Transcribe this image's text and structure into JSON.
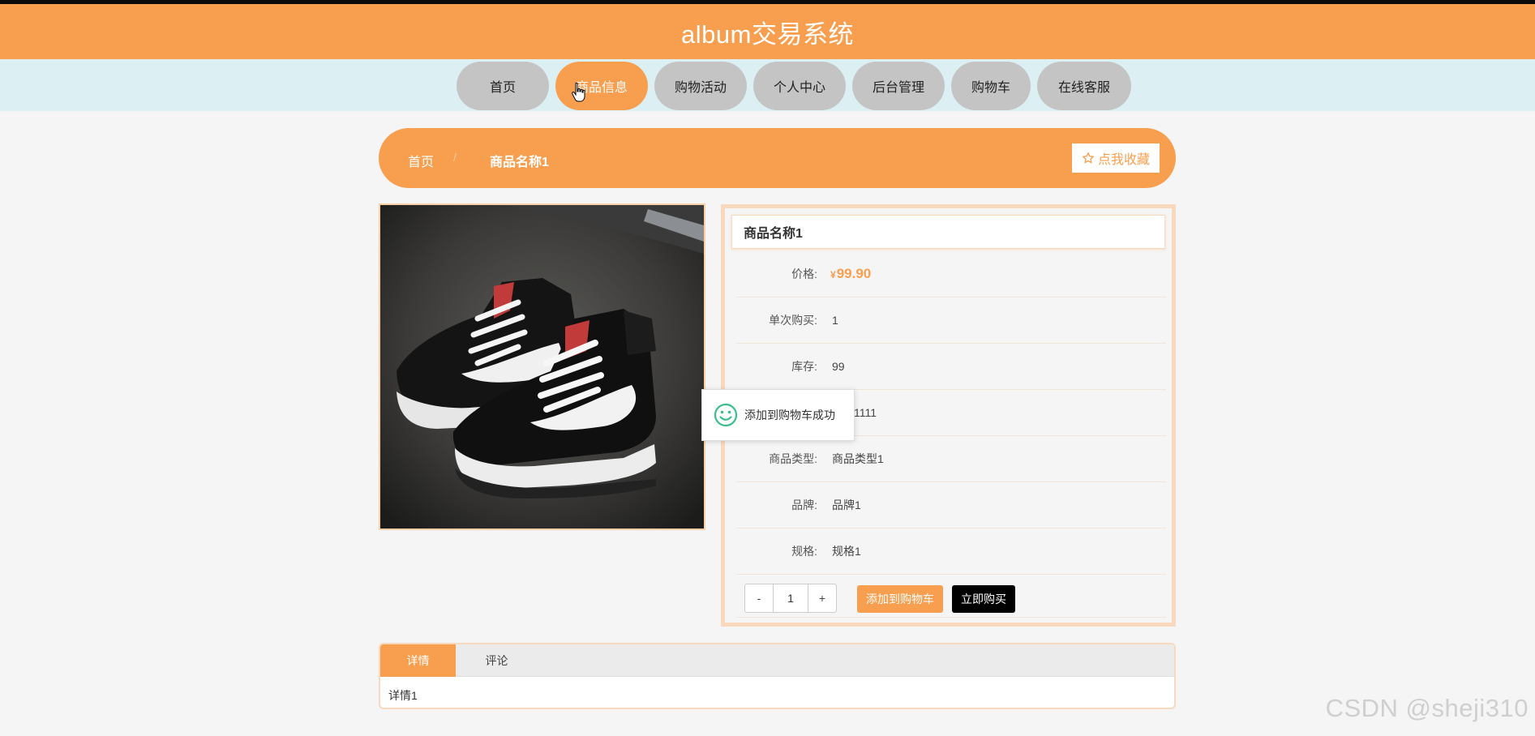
{
  "header": {
    "title": "album交易系统"
  },
  "nav": {
    "items": [
      {
        "label": "首页"
      },
      {
        "label": "商品信息"
      },
      {
        "label": "购物活动"
      },
      {
        "label": "个人中心"
      },
      {
        "label": "后台管理"
      },
      {
        "label": "购物车"
      },
      {
        "label": "在线客服"
      }
    ],
    "active": "商品信息"
  },
  "breadcrumb": {
    "home": "首页",
    "separator": "/",
    "current": "商品名称1"
  },
  "favorite_button": {
    "icon": "star-outline-icon",
    "label": "点我收藏"
  },
  "product": {
    "name": "商品名称1",
    "price_label": "价格:",
    "currency": "¥",
    "price": "99.90",
    "rows": [
      {
        "label": "单次购买:",
        "value": "1"
      },
      {
        "label": "库存:",
        "value": "99"
      },
      {
        "label": "",
        "value": "11111111"
      },
      {
        "label": "商品类型:",
        "value": "商品类型1"
      },
      {
        "label": "品牌:",
        "value": "品牌1"
      },
      {
        "label": "规格:",
        "value": "规格1"
      }
    ],
    "image": {
      "description_icon": "sneaker-photo"
    }
  },
  "quantity": {
    "minus": "-",
    "value": "1",
    "plus": "+"
  },
  "actions": {
    "add_to_cart": "添加到购物车",
    "buy_now": "立即购买"
  },
  "toast": {
    "icon": "smiley-icon",
    "message": "添加到购物车成功"
  },
  "tabs": {
    "items": [
      {
        "label": "详情"
      },
      {
        "label": "评论"
      }
    ],
    "active": "详情",
    "content": "详情1"
  },
  "watermark": "CSDN @sheji310",
  "colors": {
    "accent": "#f79f4f",
    "nav_inactive": "#c4c4c4",
    "nav_strip": "#dcf0f4",
    "toast_icon": "#3cbf8c"
  }
}
